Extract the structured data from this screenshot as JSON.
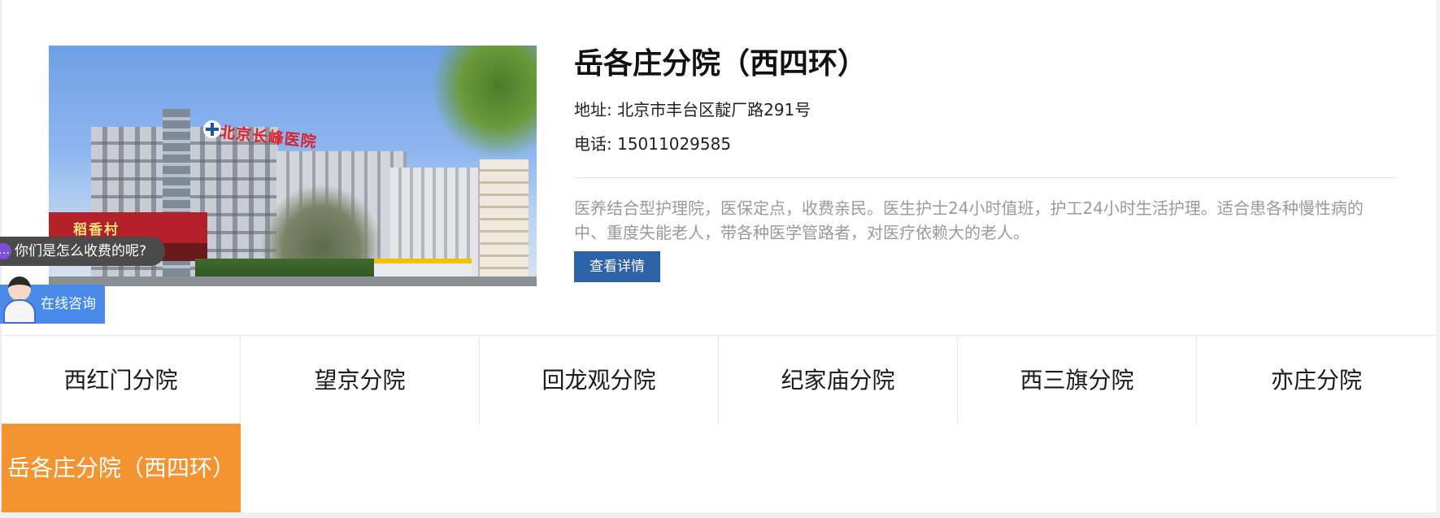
{
  "hospital": {
    "title": "岳各庄分院（西四环）",
    "address": "地址: 北京市丰台区靛厂路291号",
    "phone": "电话: 15011029585",
    "description": "医养结合型护理院，医保定点，收费亲民。医生护士24小时值班，护工24小时生活护理。适合患各种慢性病的中、重度失能老人，带各种医学管路者，对医疗依赖大的老人。",
    "detail_button": "查看详情",
    "photo_sign": "北京长峰医院",
    "photo_shop": "稻香村"
  },
  "chat": {
    "bubble_text": "你们是怎么收费的呢?",
    "consult_label": "在线咨询"
  },
  "tabs": [
    {
      "label": "西红门分院",
      "active": false
    },
    {
      "label": "望京分院",
      "active": false
    },
    {
      "label": "回龙观分院",
      "active": false
    },
    {
      "label": "纪家庙分院",
      "active": false
    },
    {
      "label": "西三旗分院",
      "active": false
    },
    {
      "label": "亦庄分院",
      "active": false
    },
    {
      "label": "岳各庄分院（西四环）",
      "active": true
    }
  ],
  "colors": {
    "active_tab": "#f39431",
    "detail_button": "#2c63a8",
    "consult_widget": "#4a8ae8",
    "description_text": "#9a9a9a"
  }
}
